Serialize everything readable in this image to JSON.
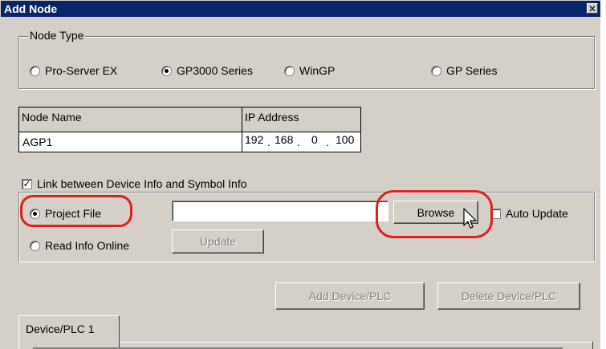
{
  "window": {
    "title": "Add Node",
    "close_glyph": "✕"
  },
  "node_type": {
    "legend": "Node Type",
    "options": [
      {
        "label": "Pro-Server EX",
        "selected": false
      },
      {
        "label": "GP3000 Series",
        "selected": true
      },
      {
        "label": "WinGP",
        "selected": false
      },
      {
        "label": "GP Series",
        "selected": false
      }
    ]
  },
  "node_table": {
    "name_header": "Node Name",
    "ip_header": "IP Address",
    "name_value": "AGP1",
    "ip_octets": [
      "192",
      "168",
      "0",
      "100"
    ]
  },
  "link_group": {
    "checkbox_label": "Link between Device Info and Symbol Info",
    "checked": true,
    "project_file_label": "Project File",
    "project_file_selected": true,
    "project_file_value": "",
    "browse_label": "Browse",
    "auto_update_label": "Auto Update",
    "auto_update_checked": false,
    "read_online_label": "Read Info Online",
    "read_online_selected": false,
    "update_label": "Update"
  },
  "buttons": {
    "add_device_label": "Add Device/PLC",
    "delete_device_label": "Delete Device/PLC"
  },
  "tabs": [
    {
      "label": "Device/PLC 1"
    }
  ],
  "colors": {
    "titlebar": "#0a246a",
    "dialog_bg": "#d4d0c8",
    "highlight": "#e0201c"
  },
  "icons": {
    "cursor": "mouse-pointer-icon",
    "checkmark": "checkmark-icon"
  }
}
